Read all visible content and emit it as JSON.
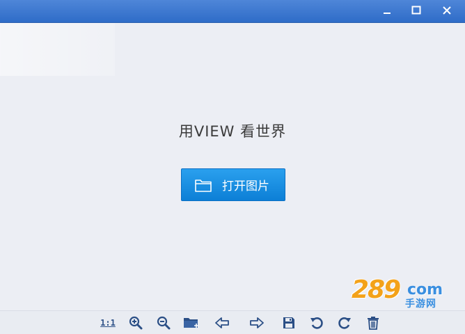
{
  "window": {
    "controls": {
      "minimize_icon": "minimize-icon",
      "maximize_icon": "maximize-icon",
      "close_icon": "close-icon"
    }
  },
  "main": {
    "tagline": "用VIEW 看世界",
    "open_button": {
      "label": "打开图片",
      "icon": "folder-icon"
    }
  },
  "watermark": {
    "number": "289",
    "suffix": "com",
    "text": "手游网"
  },
  "toolbar": {
    "actual_size_label": "1:1",
    "items": [
      {
        "name": "actual-size",
        "icon": "ratio-icon"
      },
      {
        "name": "zoom-in",
        "icon": "zoom-in-icon"
      },
      {
        "name": "zoom-out",
        "icon": "zoom-out-icon"
      },
      {
        "name": "open-folder",
        "icon": "folder-add-icon"
      },
      {
        "name": "previous",
        "icon": "arrow-left-icon"
      },
      {
        "name": "next",
        "icon": "arrow-right-icon"
      },
      {
        "name": "save",
        "icon": "save-icon"
      },
      {
        "name": "rotate-left",
        "icon": "rotate-left-icon"
      },
      {
        "name": "rotate-right",
        "icon": "rotate-right-icon"
      },
      {
        "name": "delete",
        "icon": "trash-icon"
      }
    ]
  },
  "colors": {
    "titlebar": "#3a76d0",
    "button": "#1890e2",
    "icon": "#2b4f86"
  }
}
